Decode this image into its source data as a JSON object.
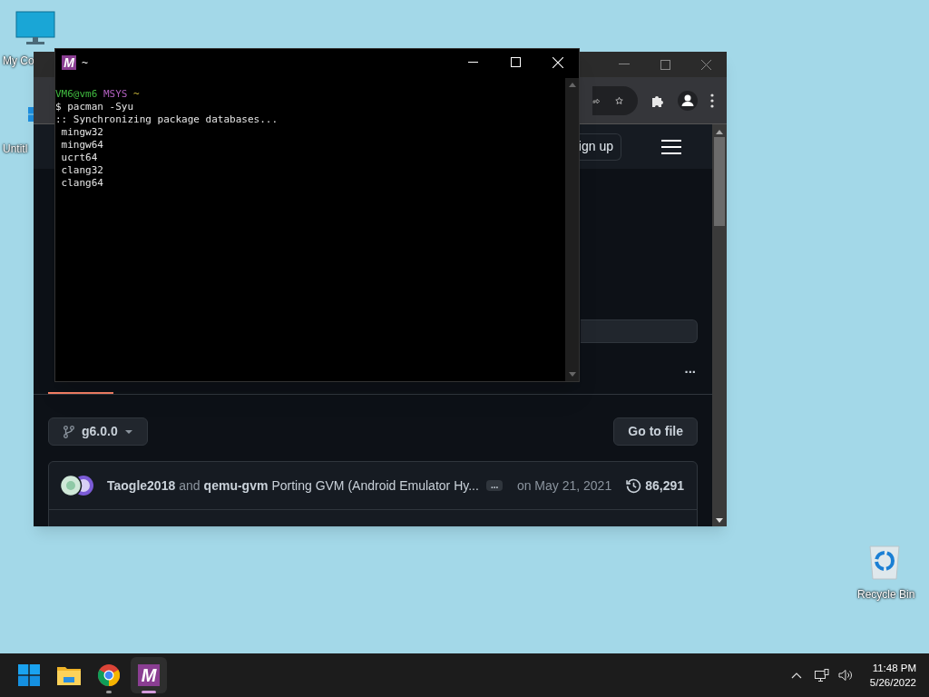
{
  "desktop_icons": [
    {
      "kind": "monitor",
      "label": "My Co"
    },
    {
      "kind": "document",
      "label": "Untitl"
    },
    {
      "kind": "recycle",
      "label": "Recycle Bin"
    }
  ],
  "browser": {
    "signup_button": "ign up",
    "branch_button": "g6.0.0",
    "go_to_file_button": "Go to file",
    "more_menu": "...",
    "commit": {
      "author": "Taogle2018",
      "joiner": "and",
      "coauthor": "qemu-gvm",
      "message": "Porting GVM (Android Emulator Hy...",
      "expand": "...",
      "date": "on May 21, 2021",
      "commit_count": "86,291"
    }
  },
  "terminal": {
    "logo": "M",
    "title": "~",
    "lines": [
      {
        "kind": "prompt",
        "user": "VM6@vm6",
        "env": "MSYS",
        "path": "~"
      },
      {
        "kind": "command",
        "text": "$ pacman -Syu"
      },
      {
        "kind": "output",
        "text": ":: Synchronizing package databases..."
      },
      {
        "kind": "output",
        "text": " mingw32"
      },
      {
        "kind": "output",
        "text": " mingw64"
      },
      {
        "kind": "output",
        "text": " ucrt64"
      },
      {
        "kind": "output",
        "text": " clang32"
      },
      {
        "kind": "output",
        "text": " clang64"
      }
    ]
  },
  "taskbar": {
    "apps": [
      {
        "kind": "start",
        "selected": false,
        "running": false
      },
      {
        "kind": "explorer",
        "selected": false,
        "running": false
      },
      {
        "kind": "chrome",
        "selected": false,
        "running": true
      },
      {
        "kind": "msys",
        "glyph": "M",
        "selected": true,
        "running": true
      }
    ],
    "time": "11:48 PM",
    "date": "5/26/2022"
  }
}
